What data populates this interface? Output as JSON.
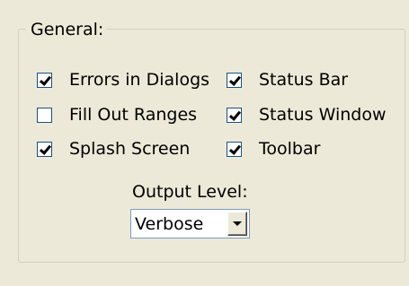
{
  "group": {
    "title": "General:"
  },
  "options": [
    {
      "label": "Errors in Dialogs",
      "checked": true
    },
    {
      "label": "Fill Out Ranges",
      "checked": false
    },
    {
      "label": "Splash Screen",
      "checked": true
    },
    {
      "label": "Status Bar",
      "checked": true
    },
    {
      "label": "Status Window",
      "checked": true
    },
    {
      "label": "Toolbar",
      "checked": true
    }
  ],
  "output_level": {
    "label": "Output Level:",
    "value": "Verbose"
  }
}
